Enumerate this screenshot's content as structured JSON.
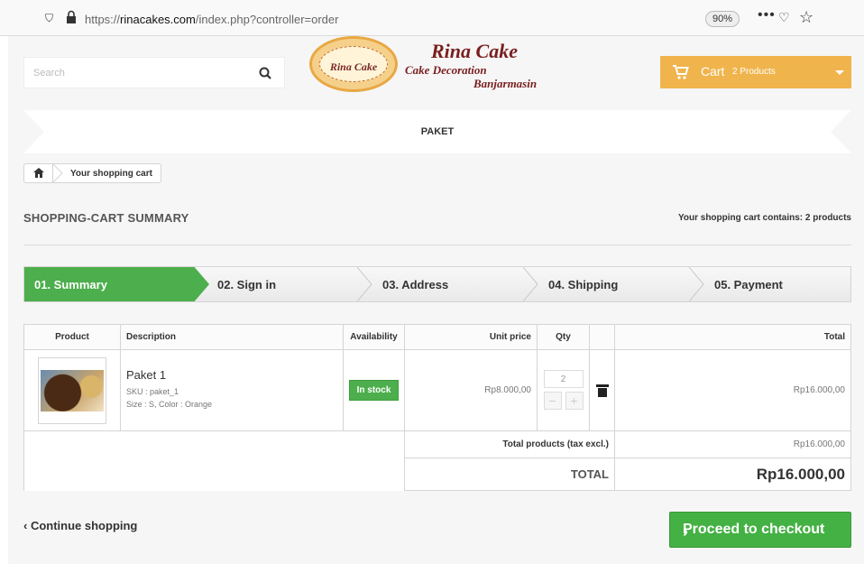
{
  "browser": {
    "url_prefix": "https://",
    "url_host": "rinacakes.com",
    "url_path": "/index.php?controller=order",
    "zoom": "90%",
    "more": "•••"
  },
  "header": {
    "search_placeholder": "Search",
    "logo_text": "Rina Cake",
    "brand_line1": "Rina Cake",
    "brand_line2": "Cake Decoration",
    "brand_line3": "Banjarmasin",
    "cart_label": "Cart",
    "cart_count": "2 Products"
  },
  "banner": {
    "title": "PAKET"
  },
  "breadcrumb": {
    "current": "Your shopping cart"
  },
  "summary": {
    "title": "SHOPPING-CART SUMMARY",
    "count_text": "Your shopping cart contains: 2 products"
  },
  "steps": [
    {
      "label": "01. Summary",
      "active": true
    },
    {
      "label": "02. Sign in",
      "active": false
    },
    {
      "label": "03. Address",
      "active": false
    },
    {
      "label": "04. Shipping",
      "active": false
    },
    {
      "label": "05. Payment",
      "active": false
    }
  ],
  "table": {
    "headers": {
      "product": "Product",
      "description": "Description",
      "availability": "Availability",
      "unit_price": "Unit price",
      "qty": "Qty",
      "total": "Total"
    },
    "rows": [
      {
        "name": "Paket 1",
        "sku": "SKU : paket_1",
        "attrs": "Size : S, Color : Orange",
        "availability": "In stock",
        "unit_price": "Rp8.000,00",
        "qty": "2",
        "total": "Rp16.000,00"
      }
    ],
    "total_products_label": "Total products (tax excl.)",
    "total_products_value": "Rp16.000,00",
    "total_label": "TOTAL",
    "total_value": "Rp16.000,00"
  },
  "actions": {
    "continue": "Continue shopping",
    "proceed": "Proceed to checkout"
  },
  "colors": {
    "accent_green": "#4cae4c",
    "cart_orange": "#f0b44c"
  }
}
